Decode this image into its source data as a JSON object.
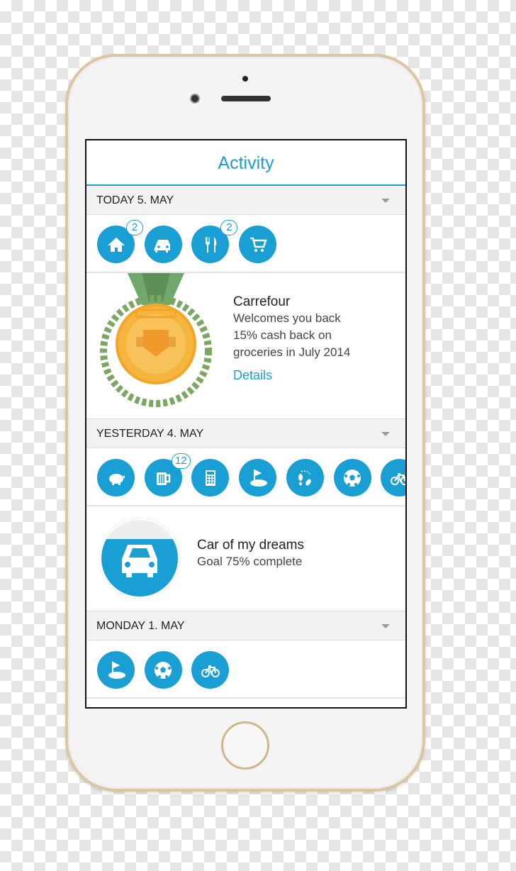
{
  "header": {
    "title": "Activity"
  },
  "sections": [
    {
      "label": "TODAY 5. MAY",
      "icons": [
        {
          "name": "home-icon",
          "badge": "2"
        },
        {
          "name": "car-icon",
          "badge": null
        },
        {
          "name": "fork-knife-icon",
          "badge": "2"
        },
        {
          "name": "shopping-cart-icon",
          "badge": null
        }
      ]
    },
    {
      "label": "YESTERDAY 4. MAY",
      "icons": [
        {
          "name": "piggy-bank-icon",
          "badge": null
        },
        {
          "name": "beer-mug-icon",
          "badge": "12"
        },
        {
          "name": "calculator-icon",
          "badge": null
        },
        {
          "name": "golf-icon",
          "badge": null
        },
        {
          "name": "footsteps-icon",
          "badge": null
        },
        {
          "name": "soccer-ball-icon",
          "badge": null
        },
        {
          "name": "bicycle-icon",
          "badge": null
        }
      ]
    },
    {
      "label": "MONDAY 1. MAY",
      "icons": [
        {
          "name": "golf-icon",
          "badge": null
        },
        {
          "name": "soccer-ball-icon",
          "badge": null
        },
        {
          "name": "bicycle-icon",
          "badge": null
        }
      ]
    }
  ],
  "reward": {
    "title": "Carrefour",
    "lines": [
      "Welcomes you back",
      "15% cash back on",
      "groceries in July 2014"
    ],
    "link": "Details"
  },
  "goal": {
    "title": "Car of my dreams",
    "text": "Goal 75% complete",
    "progress": 0.75
  },
  "colors": {
    "accent": "#1a9fd4",
    "medal": "#f6b53c",
    "ribbon": "#6fa86a"
  }
}
